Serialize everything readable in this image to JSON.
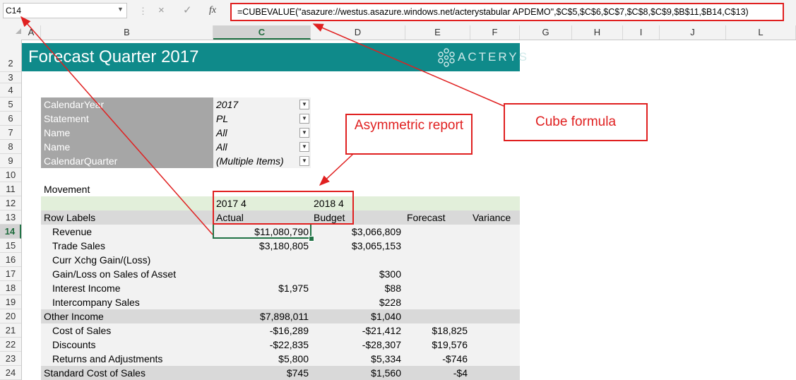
{
  "formula_bar": {
    "name_box": "C14",
    "cancel_icon": "×",
    "enter_icon": "✓",
    "fx_icon": "fx",
    "formula": "=CUBEVALUE(\"asazure://westus.asazure.windows.net/acterystabular APDEMO\",$C$5,$C$6,$C$7,$C$8,$C$9,$B$11,$B14,C$13)"
  },
  "columns": [
    "A",
    "B",
    "C",
    "D",
    "E",
    "F",
    "G",
    "H",
    "I",
    "J",
    "L"
  ],
  "rows": [
    "2",
    "3",
    "4",
    "5",
    "6",
    "7",
    "8",
    "9",
    "10",
    "11",
    "12",
    "13",
    "14",
    "15",
    "16",
    "17",
    "18",
    "19",
    "20",
    "21",
    "22",
    "23",
    "24"
  ],
  "banner": {
    "title": "Forecast Quarter 2017",
    "logo_text": "ACTERYS",
    "color": "#0f8a8a"
  },
  "filters": [
    {
      "label": "CalendarYear",
      "value": "2017",
      "icon": "filter-icon"
    },
    {
      "label": "Statement",
      "value": "PL",
      "icon": "filter-icon"
    },
    {
      "label": "Name",
      "value": "All",
      "icon": "dropdown-icon"
    },
    {
      "label": "Name",
      "value": "All",
      "icon": "dropdown-icon"
    },
    {
      "label": "CalendarQuarter",
      "value": "(Multiple Items)",
      "icon": "filter-icon"
    }
  ],
  "pivot": {
    "measure_label": "Movement",
    "header_quarters": [
      "2017 4",
      "2018 4"
    ],
    "row_labels_header": "Row Labels",
    "column_headers": [
      "Actual",
      "Budget",
      "Forecast",
      "Variance"
    ],
    "rows": [
      {
        "label": "Revenue",
        "indent": true,
        "actual": "$11,080,790",
        "budget": "$3,066,809",
        "forecast": "",
        "variance": ""
      },
      {
        "label": "Trade Sales",
        "indent": true,
        "actual": "$3,180,805",
        "budget": "$3,065,153",
        "forecast": "",
        "variance": ""
      },
      {
        "label": "Curr Xchg Gain/(Loss)",
        "indent": true,
        "actual": "",
        "budget": "",
        "forecast": "",
        "variance": ""
      },
      {
        "label": "Gain/Loss on Sales of Asset",
        "indent": true,
        "actual": "",
        "budget": "$300",
        "forecast": "",
        "variance": ""
      },
      {
        "label": "Interest Income",
        "indent": true,
        "actual": "$1,975",
        "budget": "$88",
        "forecast": "",
        "variance": ""
      },
      {
        "label": "Intercompany Sales",
        "indent": true,
        "actual": "",
        "budget": "$228",
        "forecast": "",
        "variance": ""
      },
      {
        "label": "Other Income",
        "indent": false,
        "actual": "$7,898,011",
        "budget": "$1,040",
        "forecast": "",
        "variance": ""
      },
      {
        "label": "Cost of Sales",
        "indent": true,
        "actual": "-$16,289",
        "budget": "-$21,412",
        "forecast": "$18,825",
        "variance": ""
      },
      {
        "label": "Discounts",
        "indent": true,
        "actual": "-$22,835",
        "budget": "-$28,307",
        "forecast": "$19,576",
        "variance": ""
      },
      {
        "label": "Returns and Adjustments",
        "indent": true,
        "actual": "$5,800",
        "budget": "$5,334",
        "forecast": "-$746",
        "variance": ""
      },
      {
        "label": "Standard Cost of Sales",
        "indent": false,
        "actual": "$745",
        "budget": "$1,560",
        "forecast": "-$4",
        "variance": ""
      }
    ]
  },
  "annotations": {
    "asymmetric": "Asymmetric report",
    "cube_formula": "Cube formula",
    "color": "#e02020"
  }
}
